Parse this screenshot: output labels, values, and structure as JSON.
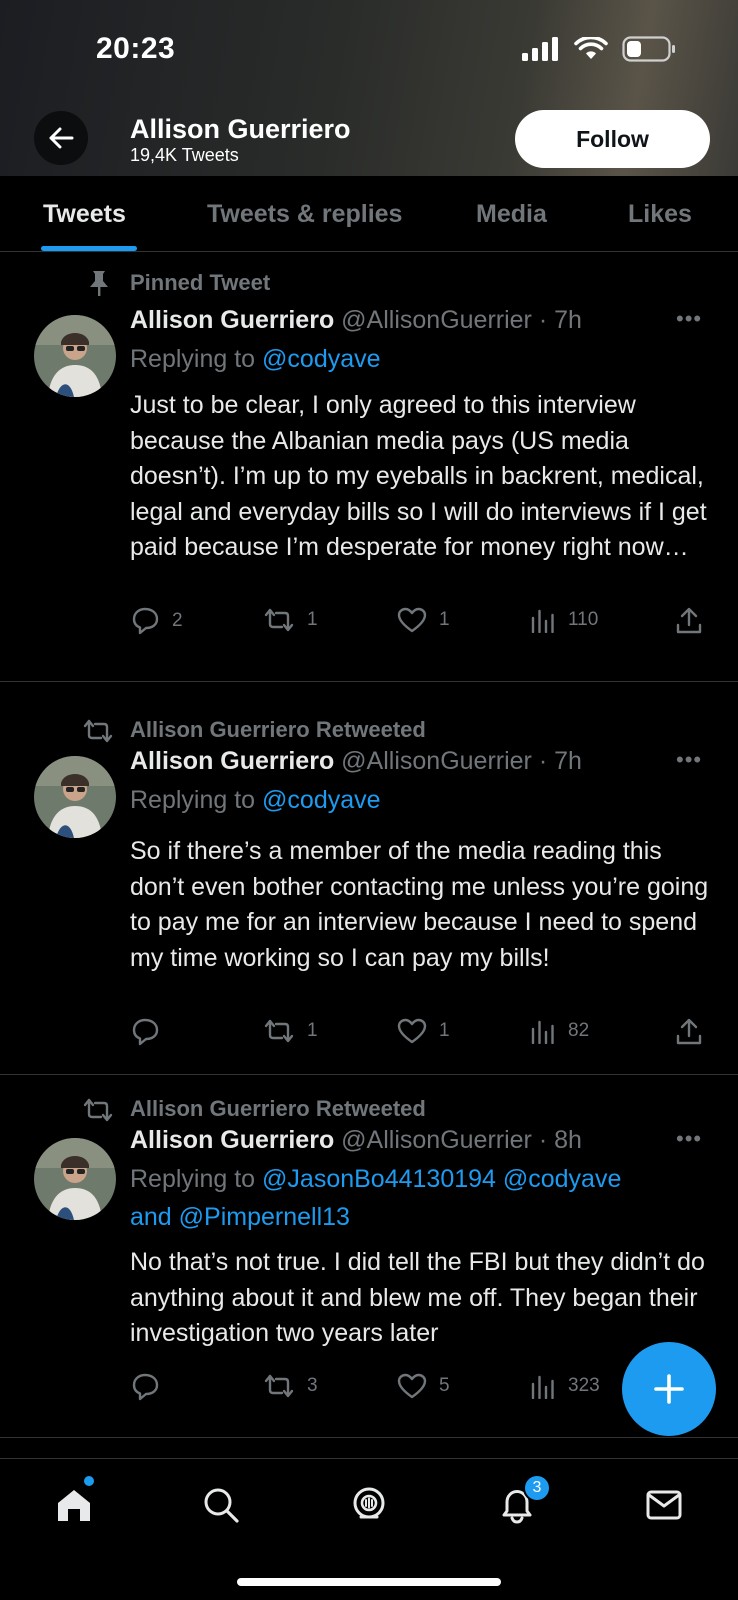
{
  "status_bar": {
    "time": "20:23"
  },
  "header": {
    "name": "Allison Guerriero",
    "tweet_count": "19,4K Tweets",
    "follow_label": "Follow"
  },
  "tabs": [
    {
      "label": "Tweets",
      "active": true
    },
    {
      "label": "Tweets & replies",
      "active": false
    },
    {
      "label": "Media",
      "active": false
    },
    {
      "label": "Likes",
      "active": false
    }
  ],
  "tweets": [
    {
      "context": "Pinned Tweet",
      "author": "Allison Guerriero",
      "handle_time": "@AllisonGuerrier · 7h",
      "replying_prefix": "Replying to",
      "replying_to": "@codyave",
      "replying_to_2": "",
      "body": "Just to be clear, I only agreed to this interview because the Albanian media pays (US media doesn’t). I’m up to my eyeballs in backrent, medical, legal and everyday bills so I will do interviews if I get paid because I’m desperate for money right now…",
      "replies": "2",
      "retweets": "1",
      "likes": "1",
      "views": "110"
    },
    {
      "context": "Allison Guerriero Retweeted",
      "author": "Allison Guerriero",
      "handle_time": "@AllisonGuerrier · 7h",
      "replying_prefix": "Replying to",
      "replying_to": "@codyave",
      "replying_to_2": "",
      "body": "So if there’s a member of the media reading this don’t even bother contacting me unless you’re going to pay me for an interview because I need to spend my time working so I can pay my bills!",
      "replies": "",
      "retweets": "1",
      "likes": "1",
      "views": "82"
    },
    {
      "context": "Allison Guerriero Retweeted",
      "author": "Allison Guerriero",
      "handle_time": "@AllisonGuerrier · 8h",
      "replying_prefix": "Replying to",
      "replying_to": "@JasonBo44130194 @codyave",
      "replying_to_2": "and @Pimpernell13",
      "body": "No that’s not true. I did tell the FBI but they didn’t do anything about it and blew me off. They began their investigation two years later",
      "replies": "",
      "retweets": "3",
      "likes": "5",
      "views": "323"
    }
  ],
  "bottom_nav": {
    "notifications_badge": "3"
  },
  "colors": {
    "accent": "#1d9bf0",
    "muted": "#71767b",
    "text": "#e7e9ea",
    "background": "#000000"
  }
}
